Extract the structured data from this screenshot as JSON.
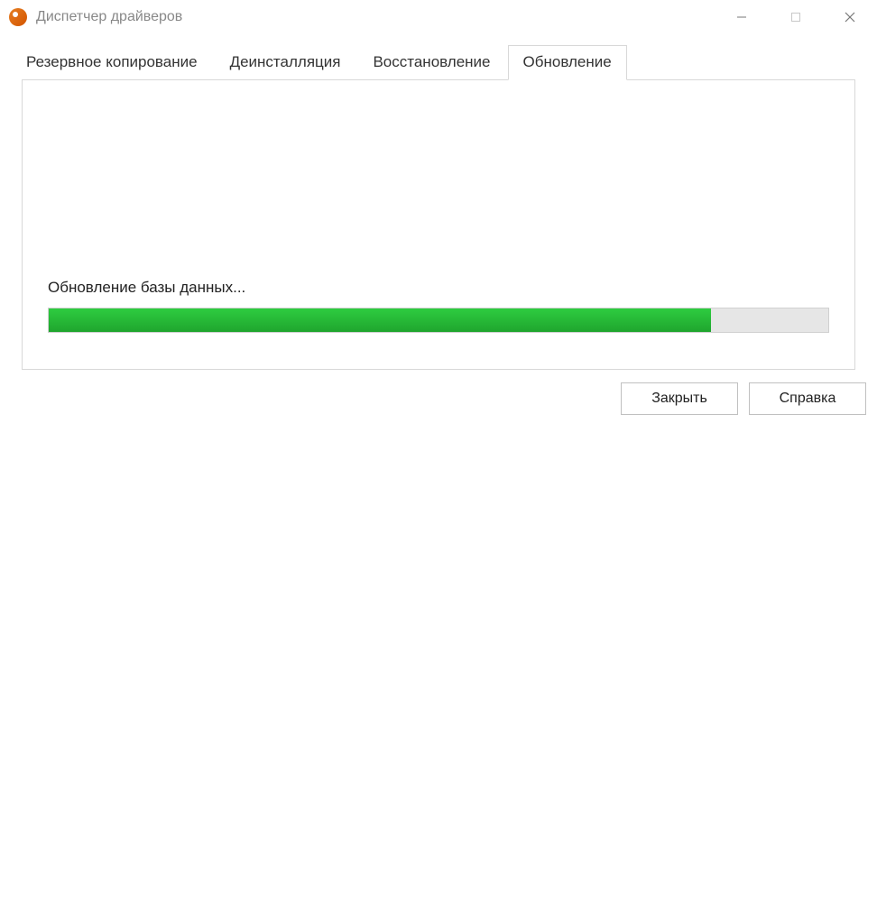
{
  "window": {
    "title": "Диспетчер драйверов"
  },
  "tabs": {
    "backup": "Резервное копирование",
    "uninstall": "Деинсталляция",
    "restore": "Восстановление",
    "update": "Обновление",
    "active": "update"
  },
  "main": {
    "status_text": "Обновление базы данных...",
    "progress_percent": 85
  },
  "footer": {
    "close_label": "Закрыть",
    "help_label": "Справка"
  }
}
